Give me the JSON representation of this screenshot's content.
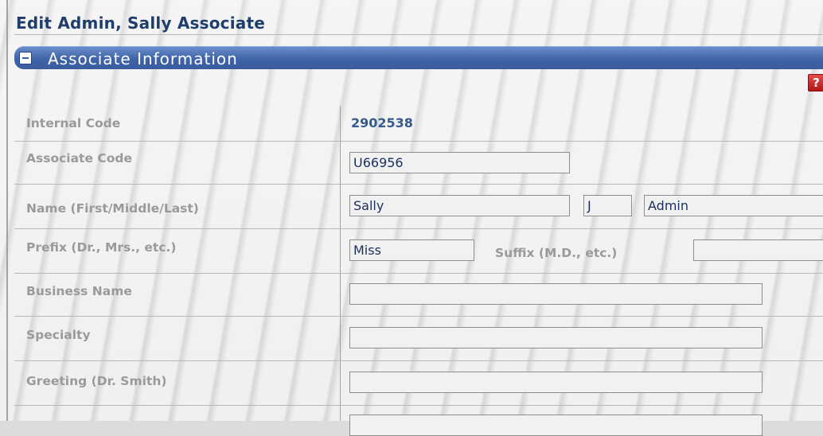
{
  "page": {
    "title": "Edit Admin, Sally Associate"
  },
  "section": {
    "title": "Associate Information",
    "help_glyph": "?"
  },
  "fields": {
    "internal_code": {
      "label": "Internal Code",
      "value": "2902538"
    },
    "associate_code": {
      "label": "Associate Code",
      "value": "U66956"
    },
    "name": {
      "label": "Name (First/Middle/Last)",
      "first": "Sally",
      "middle": "J",
      "last": "Admin"
    },
    "prefix": {
      "label": "Prefix (Dr., Mrs., etc.)",
      "value": "Miss"
    },
    "suffix": {
      "label": "Suffix (M.D., etc.)",
      "value": ""
    },
    "business_name": {
      "label": "Business Name",
      "value": ""
    },
    "specialty": {
      "label": "Specialty",
      "value": ""
    },
    "greeting": {
      "label": "Greeting (Dr. Smith)",
      "value": ""
    },
    "next_row": {
      "value": ""
    }
  },
  "colors": {
    "header": "#3f63a8",
    "title": "#1f3e6b",
    "label": "#9a9a9a",
    "value": "#355a8c",
    "help": "#c62020"
  },
  "icons": {
    "collapse": "minus-icon",
    "help": "help-icon"
  }
}
